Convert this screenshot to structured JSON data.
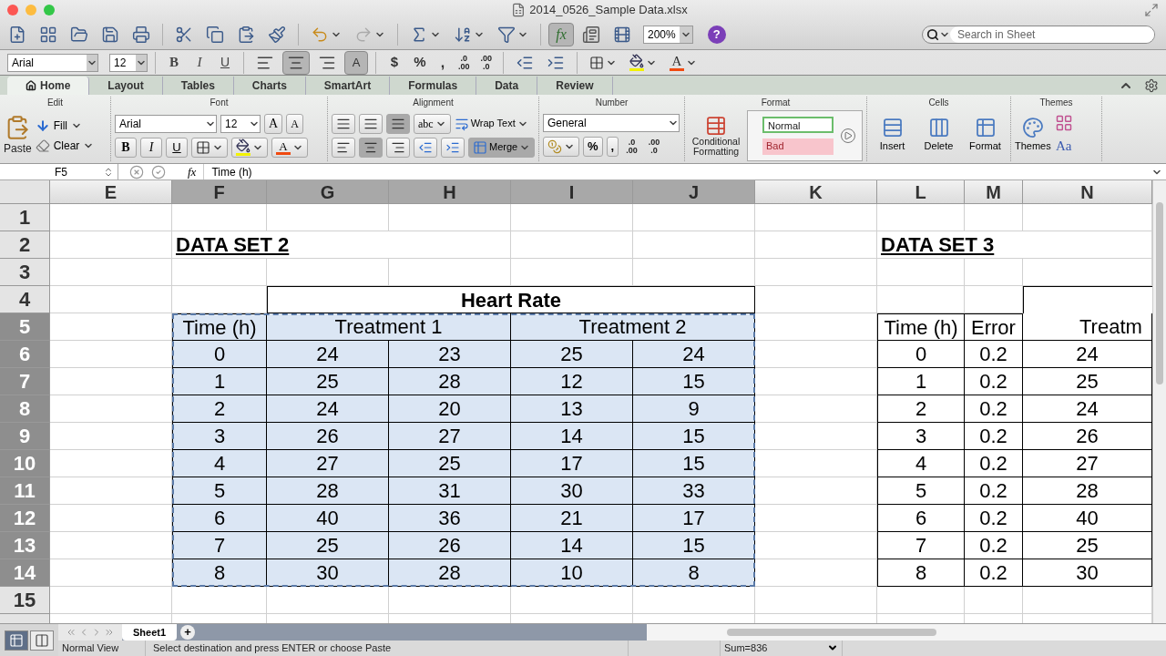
{
  "window": {
    "title": "2014_0526_Sample Data.xlsx"
  },
  "toolbar": {
    "formula_builder": {
      "label": "fx",
      "selected": true
    },
    "zoom": "200%",
    "help": "?",
    "search": {
      "placeholder": "Search in Sheet"
    }
  },
  "format_bar": {
    "font": "Arial",
    "size": "12",
    "bold": "B",
    "italic": "I",
    "underline": "U",
    "align": [
      {
        "selected": false
      },
      {
        "selected": true
      },
      {
        "selected": false
      }
    ],
    "wrap": {
      "label": "A",
      "selected": true
    },
    "currency": "$",
    "percent": "%",
    "comma": ",",
    "decimals": [
      {
        "top": ".0",
        "bottom": ".00"
      },
      {
        "top": ".00",
        "bottom": ".0"
      }
    ],
    "font_color": "A"
  },
  "ribbon": {
    "tabs": [
      {
        "label": "Home",
        "selected": true
      },
      {
        "label": "Layout",
        "selected": false
      },
      {
        "label": "Tables",
        "selected": false
      },
      {
        "label": "Charts",
        "selected": false
      },
      {
        "label": "SmartArt",
        "selected": false
      },
      {
        "label": "Formulas",
        "selected": false
      },
      {
        "label": "Data",
        "selected": false
      },
      {
        "label": "Review",
        "selected": false
      }
    ],
    "edit": {
      "title": "Edit",
      "paste": "Paste",
      "fill": "Fill",
      "clear": "Clear"
    },
    "font": {
      "title": "Font",
      "font": "Arial",
      "size": "12",
      "grow": "A",
      "shrink": "A",
      "bold": "B",
      "italic": "I",
      "underline": "U",
      "font_color": "A"
    },
    "alignment": {
      "title": "Alignment",
      "vertical": [
        {
          "selected": false
        },
        {
          "selected": false
        },
        {
          "selected": true
        }
      ],
      "orientation": "abc",
      "wrap": "Wrap Text",
      "horizontal": [
        {
          "selected": false
        },
        {
          "selected": true
        },
        {
          "selected": false
        }
      ],
      "merge": {
        "label": "Merge",
        "selected": true
      }
    },
    "number": {
      "title": "Number",
      "format": "General",
      "percent": "%",
      "comma": ",",
      "decimals": [
        {
          "top": ".0",
          "bottom": ".00"
        },
        {
          "top": ".00",
          "bottom": ".0"
        }
      ]
    },
    "format": {
      "title": "Format",
      "conditional": "Conditional Formatting",
      "styles": [
        {
          "label": "Normal",
          "kind": "normal"
        },
        {
          "label": "Bad",
          "kind": "bad"
        }
      ]
    },
    "cells": {
      "title": "Cells",
      "buttons": [
        "Insert",
        "Delete",
        "Format"
      ]
    },
    "themes": {
      "title": "Themes",
      "themes": "Themes",
      "fonts": "Aa"
    }
  },
  "formula_bar": {
    "cell": "F5",
    "fx": "fx",
    "formula": "Time (h)"
  },
  "sheet": {
    "columns": [
      {
        "label": "E",
        "selected": false
      },
      {
        "label": "F",
        "selected": true
      },
      {
        "label": "G",
        "selected": true
      },
      {
        "label": "H",
        "selected": true
      },
      {
        "label": "I",
        "selected": true
      },
      {
        "label": "J",
        "selected": true
      },
      {
        "label": "K",
        "selected": false
      },
      {
        "label": "L",
        "selected": false
      },
      {
        "label": "M",
        "selected": false
      },
      {
        "label": "N",
        "selected": false
      }
    ],
    "rows": [
      {
        "label": "1",
        "selected": false
      },
      {
        "label": "2",
        "selected": false
      },
      {
        "label": "3",
        "selected": false
      },
      {
        "label": "4",
        "selected": false
      },
      {
        "label": "5",
        "selected": true
      },
      {
        "label": "6",
        "selected": true
      },
      {
        "label": "7",
        "selected": true
      },
      {
        "label": "8",
        "selected": true
      },
      {
        "label": "9",
        "selected": true
      },
      {
        "label": "10",
        "selected": true
      },
      {
        "label": "11",
        "selected": true
      },
      {
        "label": "12",
        "selected": true
      },
      {
        "label": "13",
        "selected": true
      },
      {
        "label": "14",
        "selected": true
      },
      {
        "label": "15",
        "selected": false
      }
    ],
    "data_set_2": {
      "title": "DATA SET 2",
      "group_header": "Heart Rate",
      "selected": true,
      "headers": [
        "Time (h)",
        "Treatment 1",
        "Treatment 2"
      ],
      "rows": [
        [
          "0",
          "24",
          "23",
          "25",
          "24"
        ],
        [
          "1",
          "25",
          "28",
          "12",
          "15"
        ],
        [
          "2",
          "24",
          "20",
          "13",
          "9"
        ],
        [
          "3",
          "26",
          "27",
          "14",
          "15"
        ],
        [
          "4",
          "27",
          "25",
          "17",
          "15"
        ],
        [
          "5",
          "28",
          "31",
          "30",
          "33"
        ],
        [
          "6",
          "40",
          "36",
          "21",
          "17"
        ],
        [
          "7",
          "25",
          "26",
          "14",
          "15"
        ],
        [
          "8",
          "30",
          "28",
          "10",
          "8"
        ]
      ]
    },
    "data_set_3": {
      "title": "DATA SET 3",
      "headers": [
        "Time (h)",
        "Error",
        "Treatm"
      ],
      "rows": [
        [
          "0",
          "0.2",
          "24"
        ],
        [
          "1",
          "0.2",
          "25"
        ],
        [
          "2",
          "0.2",
          "24"
        ],
        [
          "3",
          "0.2",
          "26"
        ],
        [
          "4",
          "0.2",
          "27"
        ],
        [
          "5",
          "0.2",
          "28"
        ],
        [
          "6",
          "0.2",
          "40"
        ],
        [
          "7",
          "0.2",
          "25"
        ],
        [
          "8",
          "0.2",
          "30"
        ]
      ]
    }
  },
  "sheet_tabs": [
    {
      "label": "Sheet1",
      "selected": true
    }
  ],
  "add_sheet": "+",
  "status_bar": {
    "views": [
      {
        "selected": true
      },
      {
        "selected": false
      }
    ],
    "mode": "Normal View",
    "message": "Select destination and press ENTER or choose Paste",
    "sum": "Sum=836"
  }
}
